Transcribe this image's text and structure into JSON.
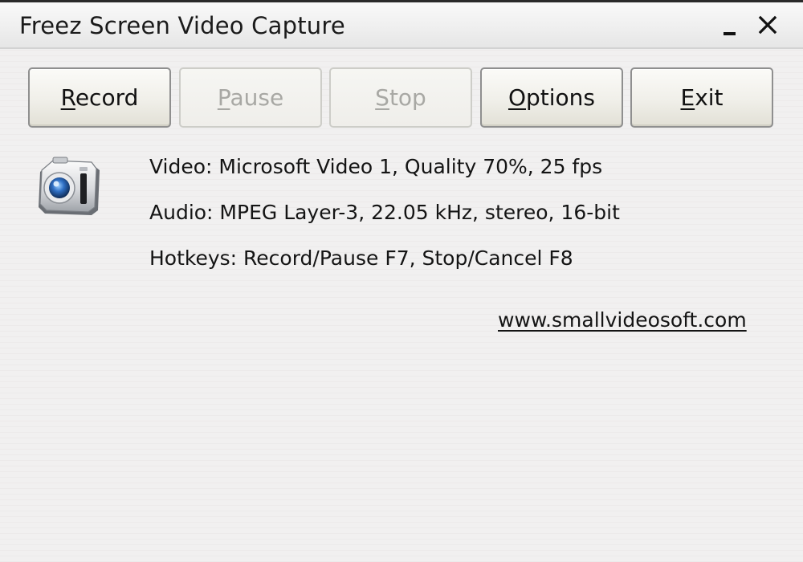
{
  "window": {
    "title": "Freez Screen Video Capture"
  },
  "toolbar": {
    "record": {
      "mnemonic": "R",
      "rest": "ecord",
      "enabled": true
    },
    "pause": {
      "mnemonic": "P",
      "rest": "ause",
      "enabled": false
    },
    "stop": {
      "mnemonic": "S",
      "rest": "top",
      "enabled": false
    },
    "options": {
      "mnemonic": "O",
      "rest": "ptions",
      "enabled": true
    },
    "exit": {
      "mnemonic": "E",
      "rest": "xit",
      "enabled": true
    }
  },
  "info": {
    "video": "Video: Microsoft Video 1, Quality 70%, 25 fps",
    "audio": "Audio: MPEG Layer-3, 22.05 kHz, stereo, 16-bit",
    "hotkeys": "Hotkeys: Record/Pause F7, Stop/Cancel F8"
  },
  "link": {
    "text": "www.smallvideosoft.com"
  },
  "icons": {
    "app": "camera-icon",
    "minimize": "minimize-icon",
    "close": "close-icon"
  },
  "colors": {
    "disabled_text": "#a8a8a4",
    "button_border": "#8f8f8f"
  }
}
